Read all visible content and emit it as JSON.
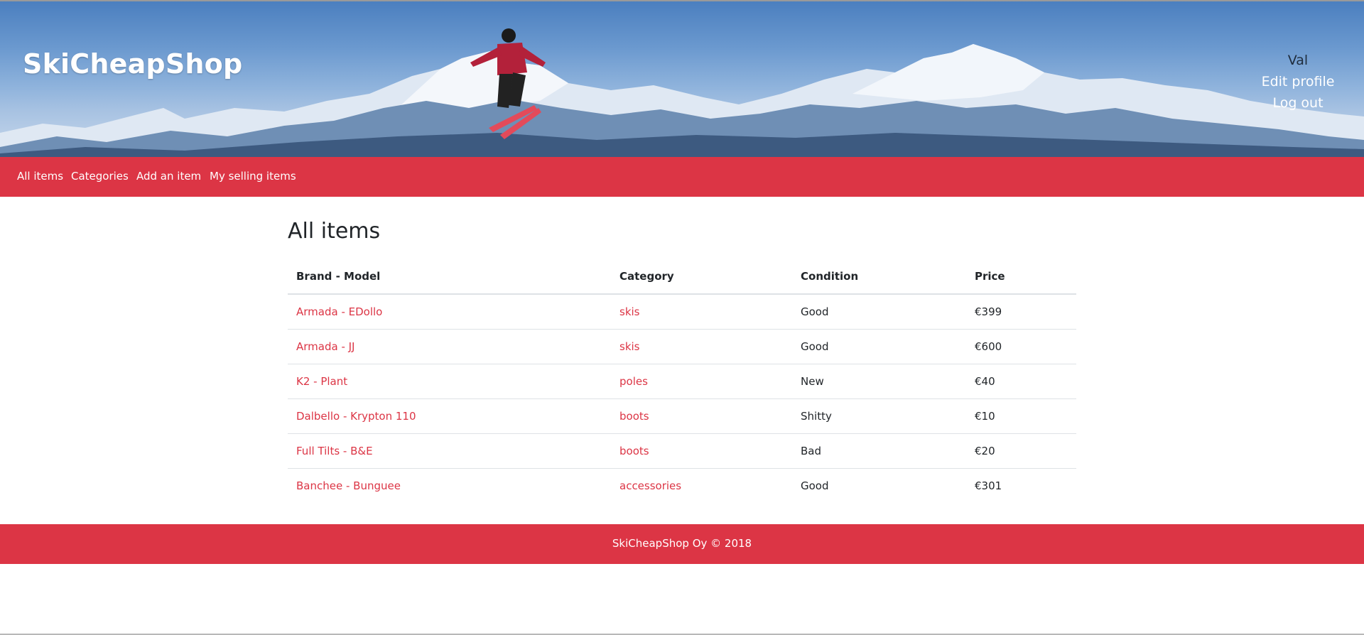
{
  "header": {
    "site_title": "SkiCheapShop",
    "user_name": "Val",
    "edit_profile": "Edit profile",
    "log_out": "Log out"
  },
  "nav": {
    "items": [
      {
        "label": "All items"
      },
      {
        "label": "Categories"
      },
      {
        "label": "Add an item"
      },
      {
        "label": "My selling items"
      }
    ]
  },
  "main": {
    "title": "All items",
    "table": {
      "headers": [
        "Brand - Model",
        "Category",
        "Condition",
        "Price"
      ],
      "rows": [
        {
          "brand_model": "Armada - EDollo",
          "category": "skis",
          "condition": "Good",
          "price": "€399"
        },
        {
          "brand_model": "Armada - JJ",
          "category": "skis",
          "condition": "Good",
          "price": "€600"
        },
        {
          "brand_model": "K2 - Plant",
          "category": "poles",
          "condition": "New",
          "price": "€40"
        },
        {
          "brand_model": "Dalbello - Krypton 110",
          "category": "boots",
          "condition": "Shitty",
          "price": "€10"
        },
        {
          "brand_model": "Full Tilts - B&E",
          "category": "boots",
          "condition": "Bad",
          "price": "€20"
        },
        {
          "brand_model": "Banchee - Bunguee",
          "category": "accessories",
          "condition": "Good",
          "price": "€301"
        }
      ]
    }
  },
  "footer": {
    "text": "SkiCheapShop Oy © 2018"
  },
  "colors": {
    "accent": "#dc3545",
    "text": "#212529",
    "sky": "#6b99cf"
  }
}
